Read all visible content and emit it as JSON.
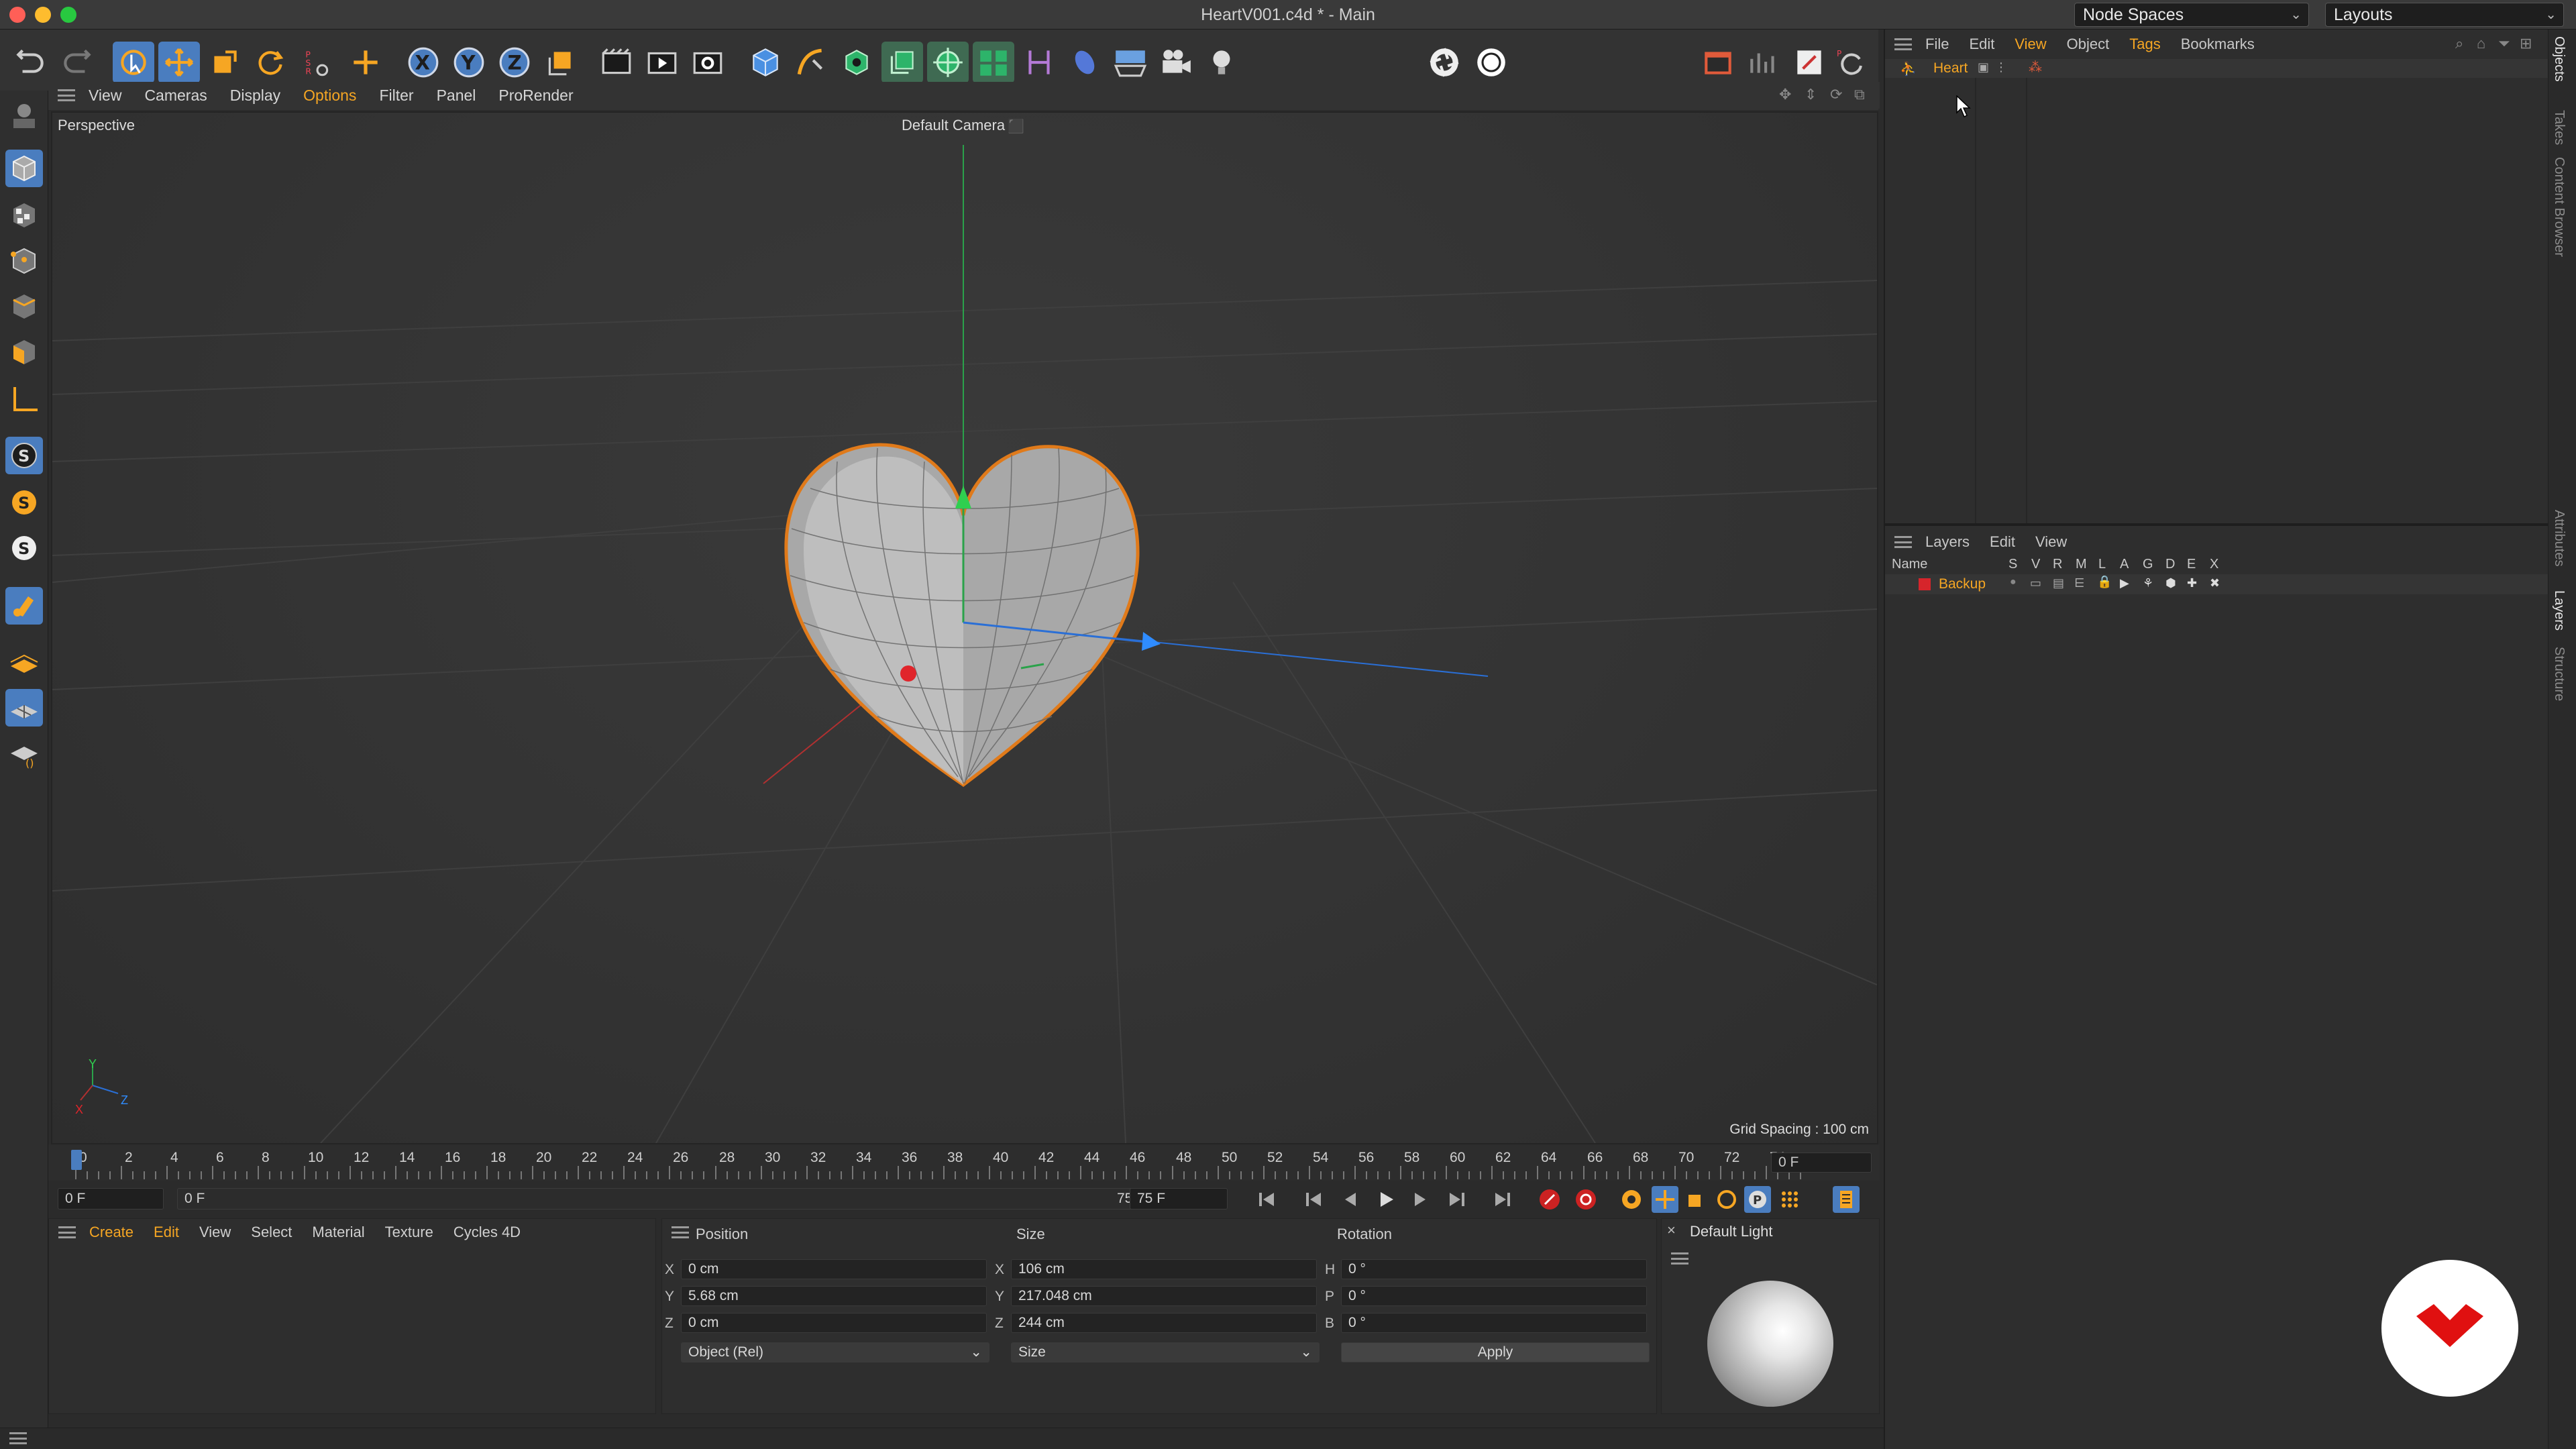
{
  "window": {
    "title": "HeartV001.c4d * - Main",
    "node_spaces": "Node Spaces",
    "layouts": "Layouts"
  },
  "colors": {
    "accent": "#ff8c00",
    "selection_blue": "#4a7dbf",
    "active_highlight": "#f6a623",
    "close": "#ff5f57",
    "minimize": "#febc2e",
    "maximize": "#28c840",
    "layer_red": "#d6252b",
    "brand_red": "#e01010"
  },
  "viewport_menu": [
    "View",
    "Cameras",
    "Display",
    "Options",
    "Filter",
    "Panel",
    "ProRender"
  ],
  "viewport": {
    "mode": "Perspective",
    "camera": "Default Camera",
    "grid_spacing": "Grid Spacing : 100 cm",
    "axis_labels": {
      "y": "Y",
      "x": "X",
      "z": "Z"
    },
    "object": "heart"
  },
  "timeline": {
    "ticks": [
      "0",
      "2",
      "4",
      "6",
      "8",
      "10",
      "12",
      "14",
      "16",
      "18",
      "20",
      "22",
      "24",
      "26",
      "28",
      "30",
      "32",
      "34",
      "36",
      "38",
      "40",
      "42",
      "44",
      "46",
      "48",
      "50",
      "52",
      "54",
      "56",
      "58",
      "60",
      "62",
      "64",
      "66",
      "68",
      "70",
      "72",
      "74"
    ],
    "current_frame": "0 F",
    "start": "0 F",
    "range_start": "0 F",
    "range_end": "75 F",
    "end": "75 F"
  },
  "material_menu": [
    "Create",
    "Edit",
    "View",
    "Select",
    "Material",
    "Texture",
    "Cycles 4D"
  ],
  "coordinates": {
    "headers": {
      "position": "Position",
      "size": "Size",
      "rotation": "Rotation"
    },
    "rows": [
      {
        "axis": "X",
        "pos": "0 cm",
        "size_axis": "X",
        "size": "106 cm",
        "rot_axis": "H",
        "rot": "0 °"
      },
      {
        "axis": "Y",
        "pos": "5.68 cm",
        "size_axis": "Y",
        "size": "217.048 cm",
        "rot_axis": "P",
        "rot": "0 °"
      },
      {
        "axis": "Z",
        "pos": "0 cm",
        "size_axis": "Z",
        "size": "244 cm",
        "rot_axis": "B",
        "rot": "0 °"
      }
    ],
    "mode": "Object (Rel)",
    "size_mode": "Size",
    "apply": "Apply"
  },
  "material_preview": {
    "title": "Default Light"
  },
  "objects": {
    "menu": [
      "File",
      "Edit",
      "View",
      "Object",
      "Tags",
      "Bookmarks"
    ],
    "items": [
      {
        "name": "Heart"
      }
    ]
  },
  "layers": {
    "menu": [
      "Layers",
      "Edit",
      "View"
    ],
    "columns": {
      "name": "Name",
      "flags": [
        "S",
        "V",
        "R",
        "M",
        "L",
        "A",
        "G",
        "D",
        "E",
        "X"
      ]
    },
    "items": [
      {
        "name": "Backup"
      }
    ]
  },
  "side_tabs": [
    "Objects",
    "Takes",
    "Content Browser",
    "Attributes",
    "Layers",
    "Structure"
  ]
}
